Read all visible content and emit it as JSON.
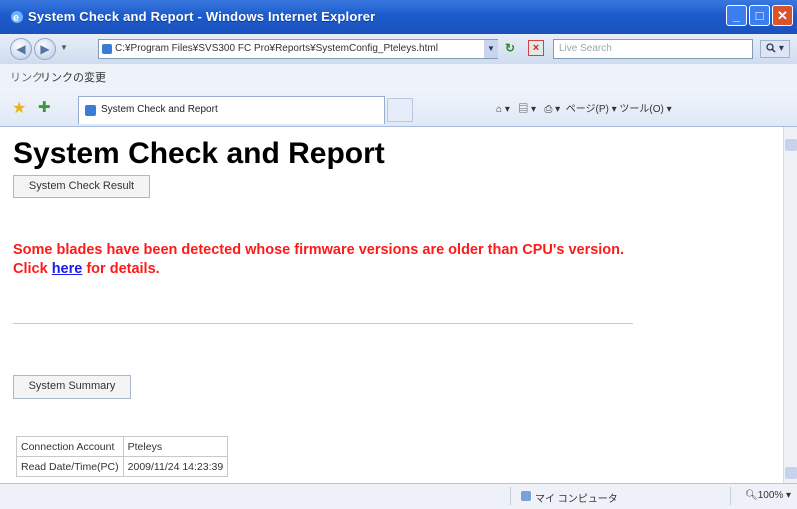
{
  "window": {
    "title": "System Check and Report - Windows Internet Explorer",
    "minimize_glyph": "_",
    "maximize_glyph": "□",
    "close_glyph": "✕"
  },
  "address_bar": {
    "url": "C:¥Program Files¥SVS300 FC Pro¥Reports¥SystemConfig_Pteleys.html",
    "search_placeholder": "Live Search",
    "back_glyph": "◀",
    "forward_glyph": "▶"
  },
  "links_bar": {
    "label": "リンク",
    "link_text": "リンクの変更"
  },
  "tab": {
    "label": "System Check and Report"
  },
  "toolbar": {
    "tools_text": "ページ(P) ▾  ツール(O) ▾"
  },
  "page": {
    "heading": "System Check and Report",
    "result_button": "System Check Result",
    "warning_line1": "Some blades have been detected whose firmware versions are older than CPU's version.",
    "warning_click": "Click ",
    "warning_link": "here",
    "warning_after_link": " for details.",
    "summary_button": "System Summary",
    "summary_rows": [
      {
        "label": "Connection Account",
        "value": "Pteleys"
      },
      {
        "label": "Read Date/Time(PC)",
        "value": "2009/11/24 14:23:39"
      }
    ]
  },
  "status_bar": {
    "zone": "マイ コンピュータ",
    "zoom": "100%"
  },
  "colors": {
    "warning": "#ff1a1a",
    "link": "#1a1aee",
    "titlebar": "#1d5bcc"
  }
}
